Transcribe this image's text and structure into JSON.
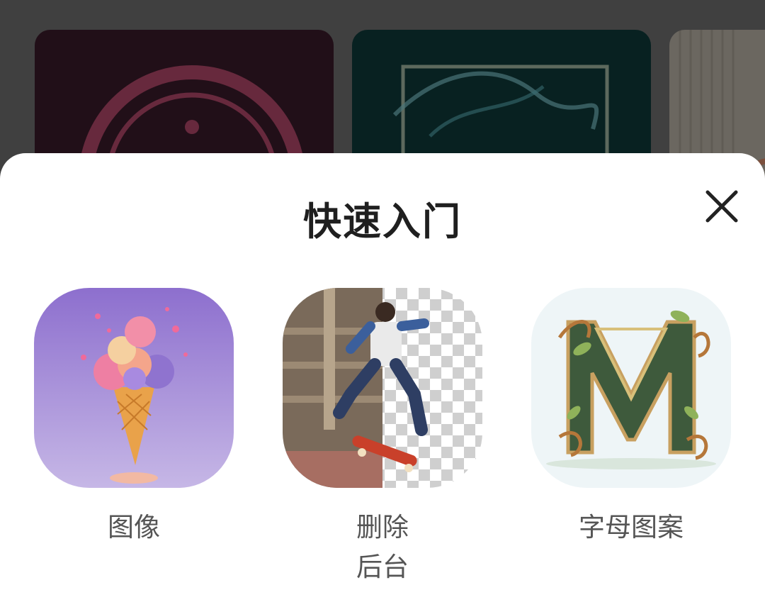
{
  "sheet": {
    "title": "快速入门"
  },
  "tiles": [
    {
      "label": "图像",
      "thumb": "ice-cream-cone"
    },
    {
      "label_line1": "删除",
      "label_line2": "后台",
      "thumb": "skateboarder-cutout"
    },
    {
      "label": "字母图案",
      "thumb": "letter-m-quilling"
    }
  ],
  "colors": {
    "sheet_bg": "#ffffff",
    "title": "#1f1f1f",
    "label": "#555555",
    "scrim": "#6e6e6e"
  }
}
